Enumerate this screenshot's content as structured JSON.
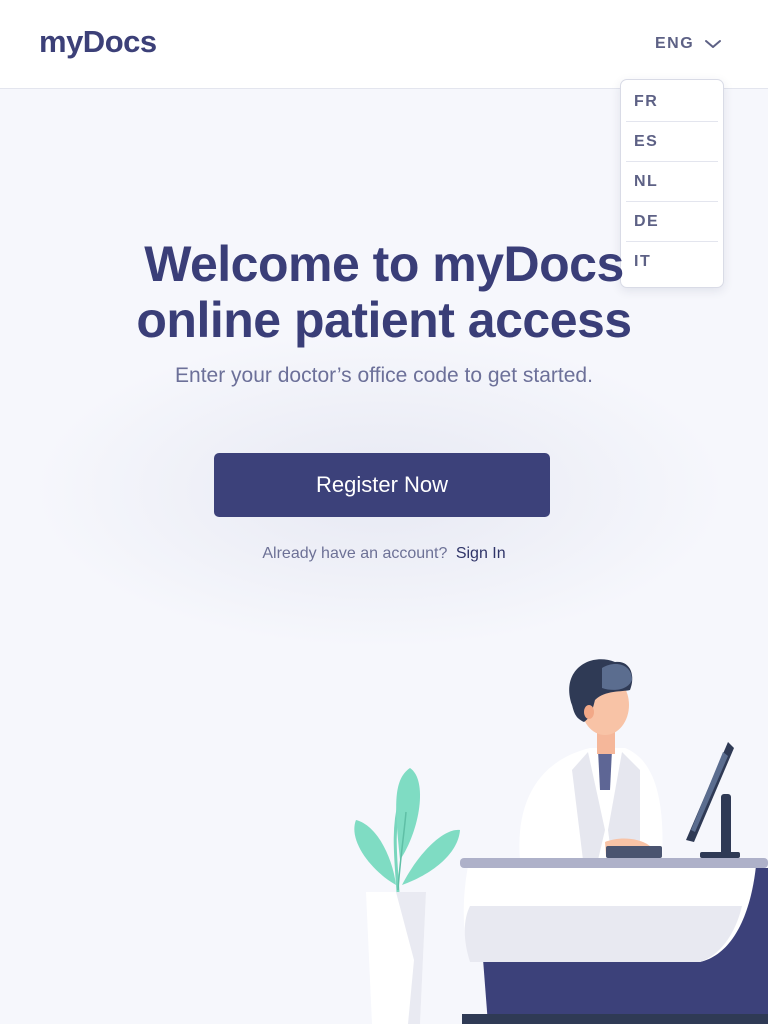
{
  "brand": {
    "logo_text": "myDocs"
  },
  "language": {
    "current": "ENG",
    "options": [
      "FR",
      "ES",
      "NL",
      "DE",
      "IT"
    ]
  },
  "hero": {
    "title_line1": "Welcome to myDocs",
    "title_line2": "online patient access",
    "subtitle": "Enter your doctor’s office code to get started."
  },
  "actions": {
    "register_label": "Register Now",
    "signin_prompt": "Already have an account?",
    "signin_label": "Sign In"
  },
  "colors": {
    "brand_navy": "#3c417a",
    "background": "#f6f7fc",
    "plant_green": "#7fdcc3",
    "muted_text": "#6c7099"
  },
  "illustration": {
    "name": "doctor-at-desk-illustration"
  }
}
